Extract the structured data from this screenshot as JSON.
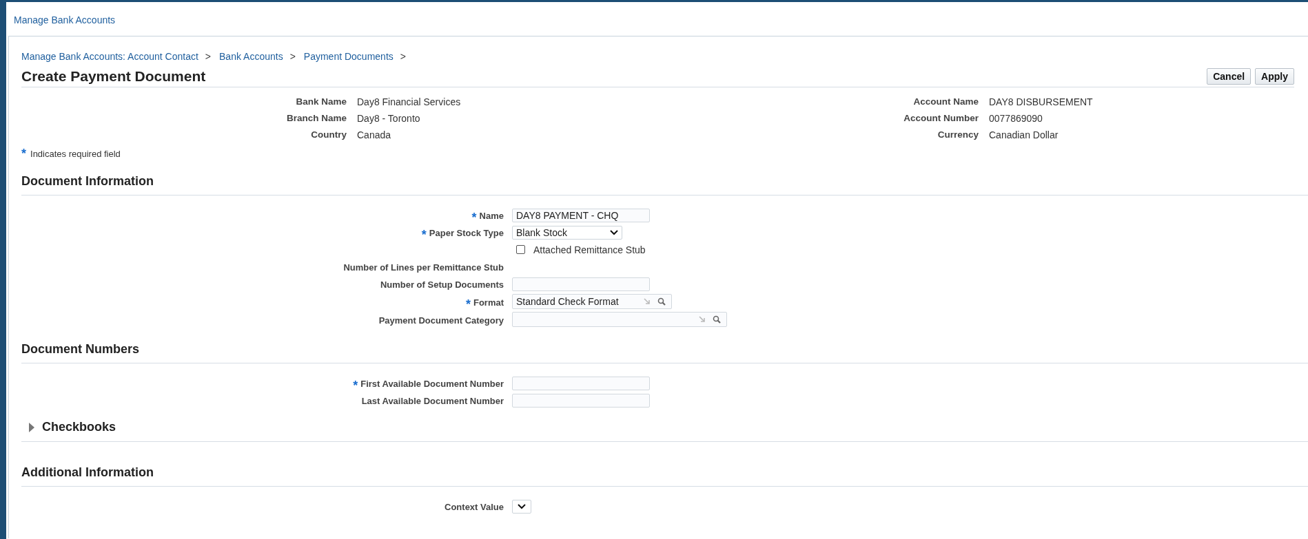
{
  "header_link": "Manage Bank Accounts",
  "breadcrumbs": [
    "Manage Bank Accounts: Account Contact",
    "Bank Accounts",
    "Payment Documents"
  ],
  "breadcrumb_separator": ">",
  "title": "Create Payment Document",
  "buttons": [
    "Cancel",
    "Apply"
  ],
  "bank_details": {
    "left": [
      {
        "label": "Bank Name",
        "value": "Day8 Financial Services"
      },
      {
        "label": "Branch Name",
        "value": "Day8 - Toronto"
      },
      {
        "label": "Country",
        "value": "Canada"
      }
    ],
    "right": [
      {
        "label": "Account Name",
        "value": "DAY8 DISBURSEMENT"
      },
      {
        "label": "Account Number",
        "value": "0077869090"
      },
      {
        "label": "Currency",
        "value": "Canadian Dollar"
      }
    ]
  },
  "required_marker": "*",
  "required_note": "Indicates required field",
  "sections": [
    {
      "title": "Document Information",
      "kind": "heading",
      "fields": [
        {
          "kind": "text",
          "label": "Name",
          "required": true,
          "value": "DAY8 PAYMENT - CHQ"
        },
        {
          "kind": "select",
          "label": "Paper Stock Type",
          "required": true,
          "value": "Blank Stock"
        },
        {
          "kind": "checkbox",
          "label": "Attached Remittance Stub",
          "checked": false
        },
        {
          "kind": "label",
          "label": "Number of Lines per Remittance Stub",
          "required": false
        },
        {
          "kind": "text",
          "label": "Number of Setup Documents",
          "required": false
        },
        {
          "kind": "lov",
          "label": "Format",
          "required": true,
          "value": "Standard Check Format"
        },
        {
          "kind": "lov_wide",
          "label": "Payment Document Category",
          "required": false
        }
      ]
    },
    {
      "title": "Document Numbers",
      "kind": "heading",
      "fields": [
        {
          "kind": "text",
          "label": "First Available Document Number",
          "required": true
        },
        {
          "kind": "text",
          "label": "Last Available Document Number",
          "required": false
        }
      ]
    },
    {
      "title": "Checkbooks",
      "kind": "collapsible",
      "expanded": false
    },
    {
      "title": "Additional Information",
      "kind": "heading",
      "fields": [
        {
          "kind": "select_small",
          "label": "Context Value",
          "required": false
        }
      ]
    }
  ]
}
